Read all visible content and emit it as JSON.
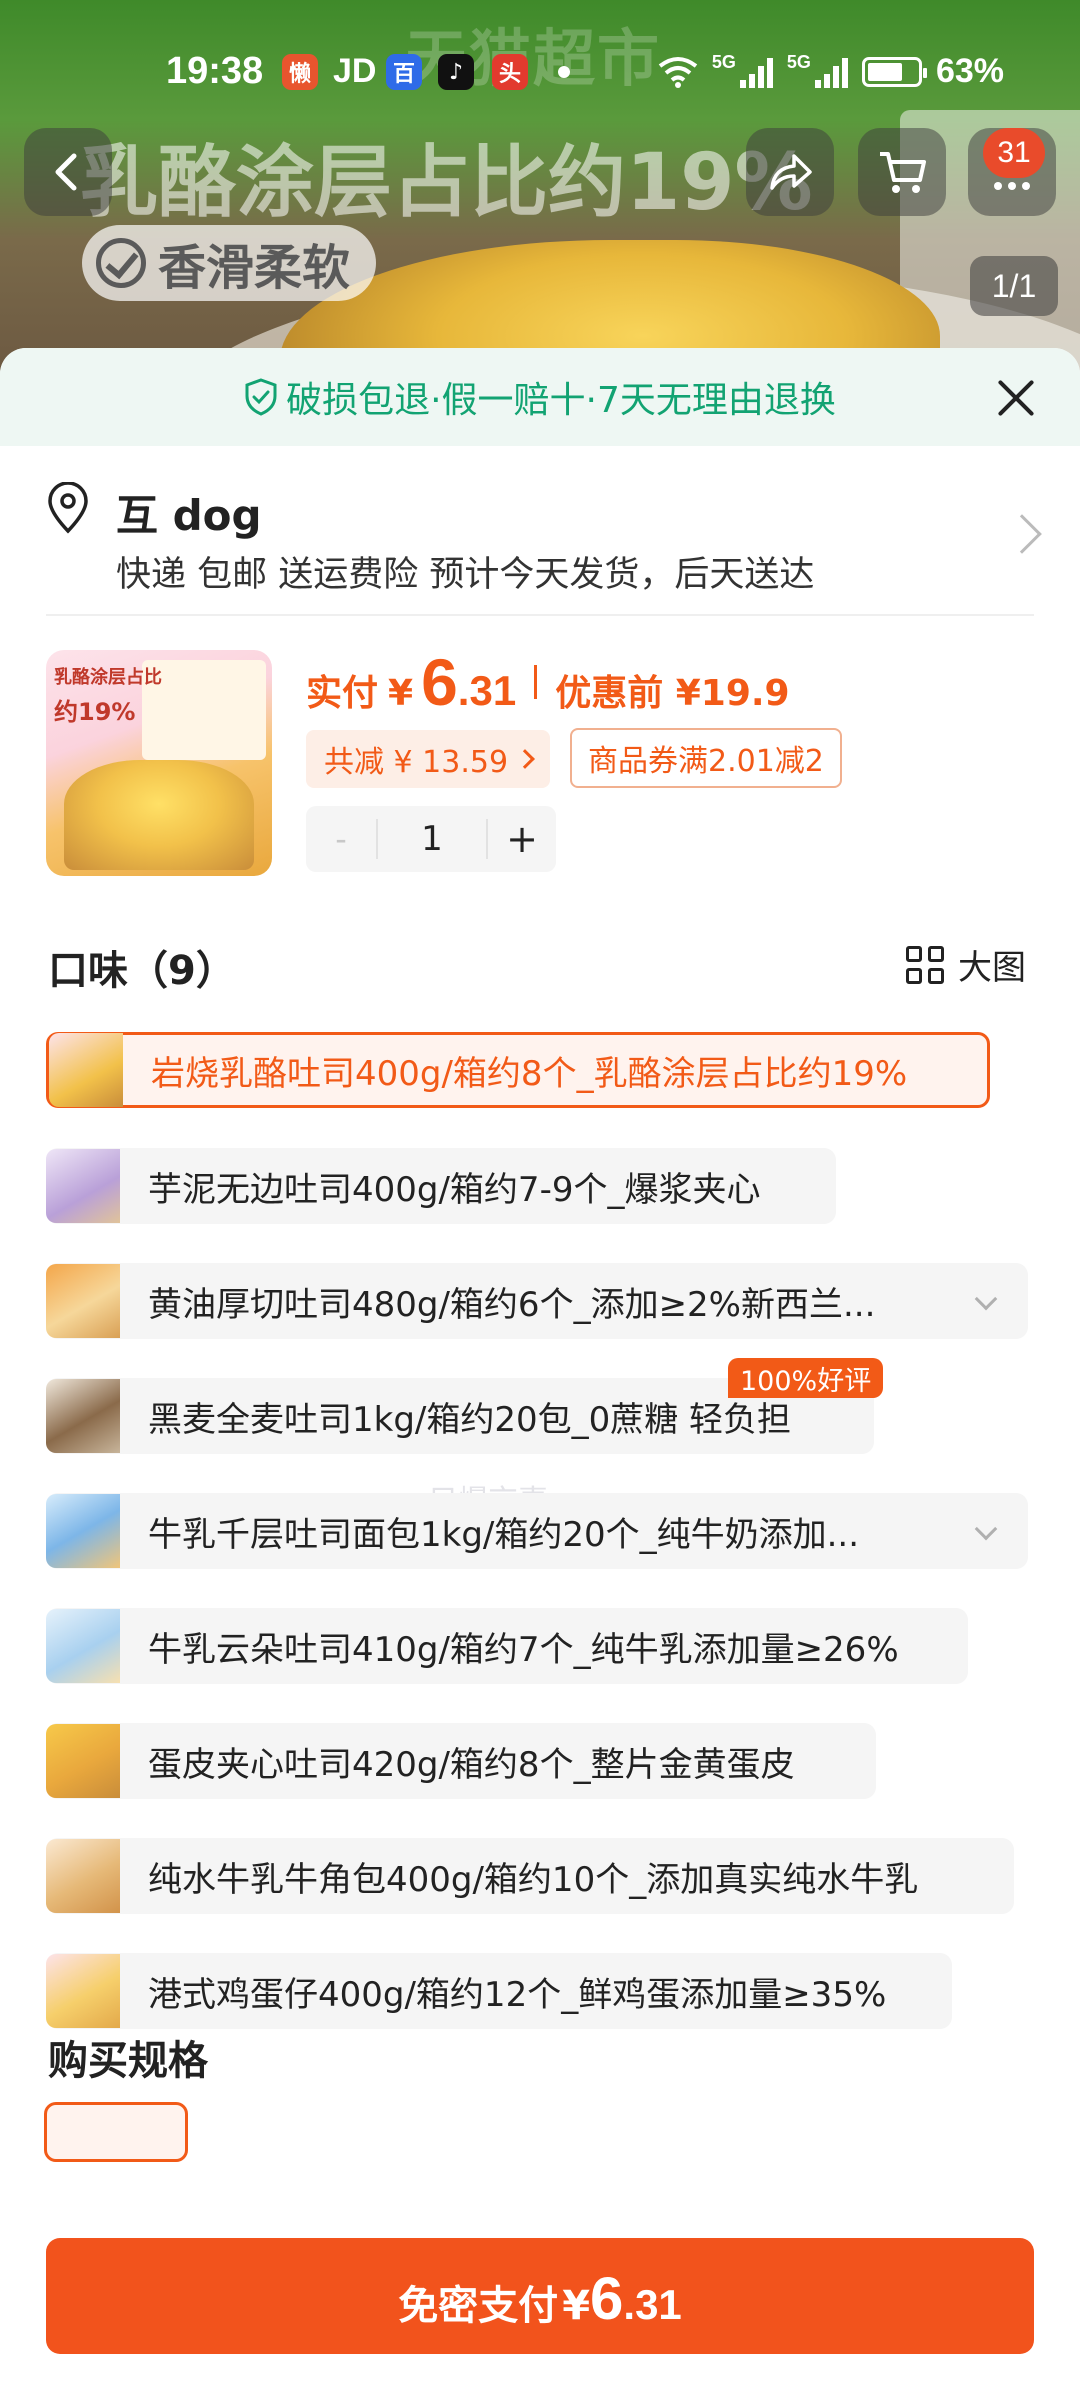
{
  "status_bar": {
    "time": "19:38",
    "app_icons": [
      "lazy-app-icon",
      "jd-app-icon",
      "baidu-app-icon",
      "tiktok-app-icon",
      "toutiao-app-icon"
    ],
    "jd_label": "JD",
    "network_1": "5G",
    "network_2": "5G",
    "battery": "63%"
  },
  "hero": {
    "watermark": "天猫超市",
    "caption": "乳酪涂层占比约19%",
    "tagline": "香滑柔软",
    "cart_count": "31",
    "image_counter": "1/1"
  },
  "sheet": {
    "guarantee": "破损包退·假一赔十·7天无理由退换",
    "address": {
      "name": "互 dog",
      "detail": "快递 包邮 送运费险 预计今天发货，后天送达"
    },
    "product": {
      "thumb_text_1": "乳酪涂层占比",
      "thumb_text_2": "约19%",
      "price_label": "实付",
      "currency": "¥",
      "price_int": "6",
      "price_dec": ".31",
      "before_label": "优惠前 ¥19.9",
      "total_discount": "共减 ¥ 13.59",
      "coupon": "商品券满2.01减2",
      "quantity": "1",
      "minus": "-",
      "plus": "+"
    },
    "flavor": {
      "title": "口味（9）",
      "big_view": "大图",
      "options": [
        {
          "label": "岩烧乳酪吐司400g/箱约8个_乳酪涂层占比约19%",
          "selected": true
        },
        {
          "label": "芋泥无边吐司400g/箱约7-9个_爆浆夹心"
        },
        {
          "label": "黄油厚切吐司480g/箱约6个_添加≥2%新西兰..."
        },
        {
          "label": "黑麦全麦吐司1kg/箱约20包_0蔗糖 轻负担",
          "badge": "100%好评"
        },
        {
          "label": "牛乳千层吐司面包1kg/箱约20个_纯牛奶添加..."
        },
        {
          "label": "牛乳云朵吐司410g/箱约7个_纯牛乳添加量≥26%"
        },
        {
          "label": "蛋皮夹心吐司420g/箱约8个_整片金黄蛋皮"
        },
        {
          "label": "纯水牛乳牛角包400g/箱约10个_添加真实纯水牛乳"
        },
        {
          "label": "港式鸡蛋仔400g/箱约12个_鲜鸡蛋添加量≥35%"
        }
      ],
      "faint_watermark": "只爆京喜"
    },
    "spec_title": "购买规格",
    "pay": {
      "label": "免密支付",
      "currency": "¥",
      "int": "6",
      "dec": ".31"
    }
  },
  "colors": {
    "accent": "#f25a17",
    "guarantee_green": "#12a372",
    "guarantee_bg": "#eef7f3"
  }
}
